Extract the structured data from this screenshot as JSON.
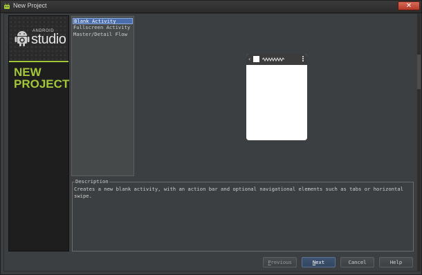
{
  "window": {
    "title": "New Project",
    "close_glyph": "✕",
    "accent_color": "#a4c639",
    "selection_color": "#4b6eaf"
  },
  "sidebar": {
    "brand_small": "ANDROID",
    "brand_big": "studio",
    "heading_line1": "NEW",
    "heading_line2": "PROJECT",
    "icon": "android-robot-icon"
  },
  "templates": {
    "items": [
      "Blank Activity",
      "Fullscreen Activity",
      "Master/Detail Flow"
    ],
    "selected_index": 0
  },
  "preview": {
    "icons": [
      "back-chevron-icon",
      "app-icon",
      "title-squiggle-icon",
      "overflow-menu-icon"
    ]
  },
  "description": {
    "legend": "Description",
    "text": "Creates a new blank activity, with an action bar and optional navigational elements such as tabs or horizontal swipe."
  },
  "buttons": {
    "previous": {
      "mnemonic": "P",
      "rest": "revious"
    },
    "next": {
      "mnemonic": "N",
      "rest": "ext"
    },
    "cancel": "Cancel",
    "help": "Help"
  }
}
